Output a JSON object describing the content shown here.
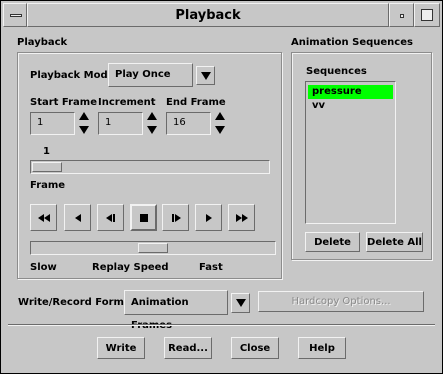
{
  "window": {
    "title": "Playback"
  },
  "playback": {
    "group_label": "Playback",
    "mode_label": "Playback Mode",
    "mode_value": "Play Once",
    "start_frame_label": "Start Frame",
    "increment_label": "Increment",
    "end_frame_label": "End Frame",
    "start_frame_value": "1",
    "increment_value": "1",
    "end_frame_value": "16",
    "frame_value": "1",
    "frame_label": "Frame",
    "speed_slow_label": "Slow",
    "speed_label": "Replay Speed",
    "speed_fast_label": "Fast",
    "frame_slider_fraction": 0.0,
    "speed_slider_fraction": 0.5
  },
  "transport": {
    "icons": [
      "rewind-icon",
      "step-back-icon",
      "play-reverse-icon",
      "stop-icon",
      "play-forward-icon",
      "step-forward-icon",
      "fast-forward-icon"
    ]
  },
  "sequences": {
    "group_label": "Animation Sequences",
    "list_label": "Sequences",
    "items": [
      "pressure",
      "vv"
    ],
    "selected": "pressure",
    "delete_label": "Delete",
    "delete_all_label": "Delete All"
  },
  "format": {
    "label": "Write/Record Format",
    "value": "Animation Frames",
    "hardcopy_label": "Hardcopy Options..."
  },
  "actions": {
    "write_label": "Write",
    "read_label": "Read...",
    "close_label": "Close",
    "help_label": "Help"
  },
  "colors": {
    "background": "#c7c7c7",
    "selection": "#00ff00"
  }
}
